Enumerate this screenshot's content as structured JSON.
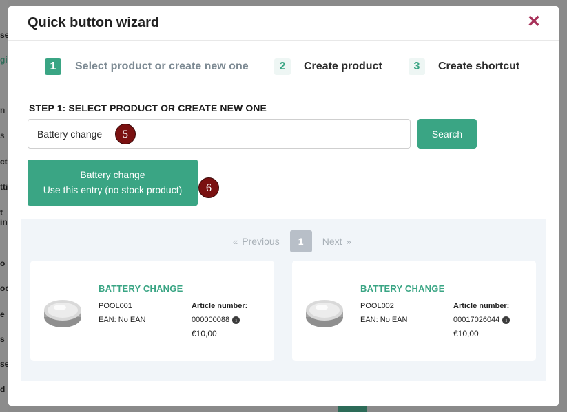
{
  "background": {
    "fragments": [
      "se",
      "gis",
      "n",
      "s",
      "ctio",
      "ttin",
      "t in",
      "o",
      "oo",
      "e",
      "s",
      "se",
      "d"
    ]
  },
  "modal": {
    "title": "Quick button wizard",
    "close_icon": "close-icon"
  },
  "steps": [
    {
      "num": "1",
      "label": "Select product or create new one",
      "active": true
    },
    {
      "num": "2",
      "label": "Create product",
      "active": false
    },
    {
      "num": "3",
      "label": "Create shortcut",
      "active": false
    }
  ],
  "step_heading": "STEP 1: SELECT PRODUCT OR CREATE NEW ONE",
  "search": {
    "value": "Battery change",
    "button_label": "Search"
  },
  "badges": {
    "search_badge": "5",
    "entry_badge": "6"
  },
  "entry_button": {
    "line1": "Battery change",
    "line2": "Use this entry (no stock product)"
  },
  "pagination": {
    "previous_label": "Previous",
    "page": "1",
    "next_label": "Next",
    "prev_chevron": "«",
    "next_chevron": "»"
  },
  "products": [
    {
      "title": "BATTERY CHANGE",
      "code": "POOL001",
      "ean_label": "EAN",
      "ean_value": "No EAN",
      "article_label": "Article number:",
      "article_number": "000000088",
      "price": "€10,00",
      "icon": "coin-battery-icon"
    },
    {
      "title": "BATTERY CHANGE",
      "code": "POOL002",
      "ean_label": "EAN",
      "ean_value": "No EAN",
      "article_label": "Article number:",
      "article_number": "00017026044",
      "price": "€10,00",
      "icon": "coin-battery-icon"
    }
  ],
  "colors": {
    "accent": "#3aa584",
    "close": "#a8325a",
    "badge": "#7a1111",
    "panel": "#f1f5f9"
  }
}
